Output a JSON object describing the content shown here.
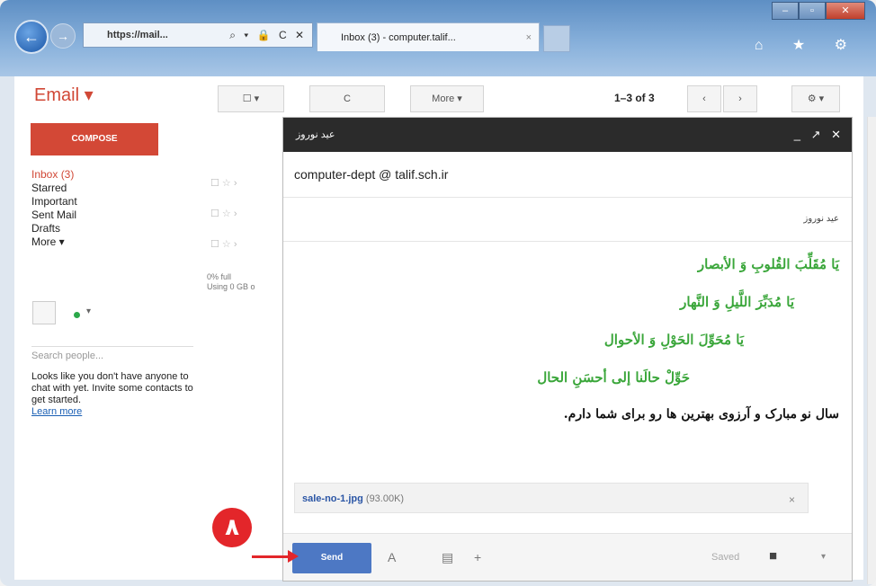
{
  "browser": {
    "address": "https://mail...",
    "address_controls": "⌕ ▾ 🔒 C ✕",
    "tab_title": "Inbox (3) - computer.talif...",
    "tab_close": "×",
    "window_buttons": [
      "–",
      "▫",
      "✕"
    ],
    "right_icons": "⌂ ★ ⚙"
  },
  "gmail": {
    "logo": "Email ▾",
    "toolbar": {
      "select": "☐ ▾",
      "refresh": "C",
      "more": "More ▾",
      "pager": "1–3 of 3",
      "settings": "⚙ ▾"
    },
    "compose": "COMPOSE",
    "folders": [
      "Inbox (3)",
      "Starred",
      "Important",
      "Sent Mail",
      "Drafts",
      "More ▾"
    ],
    "search_people": "Search people...",
    "chat_msg": "Looks like you don't have anyone to chat with yet. Invite some contacts to get started.",
    "learn_more": "Learn more",
    "storage": "0% full\nUsing 0 GB o"
  },
  "compose_window": {
    "title": "عید نوروز",
    "controls": "_ ↗ ✕",
    "to": "computer-dept @ talif.sch.ir",
    "subject": "عید نوروز",
    "body": [
      "يَا مُقَلِّبَ القُلوبِ وَ الأبصار",
      "يَا مُدَبِّرَ اللَّيلِ وَ النَّهار",
      "يَا مُحَوِّلَ الحَوْلِ وَ الأحوال",
      "حَوِّلْ حالَنا إلى أحسَنِ الحال",
      "سال نو مبارک و آرزوی بهترین ها رو برای شما دارم."
    ],
    "attachment_name": "sale-no-1.jpg",
    "attachment_size": "(93.00K)",
    "send": "Send",
    "saved": "Saved"
  },
  "annotation": {
    "step_number": "۸"
  },
  "colors": {
    "gmail_red": "#d34836",
    "send_blue": "#4d78c4",
    "arabic_green": "#3aa63a",
    "callout_red": "#e3262a"
  }
}
